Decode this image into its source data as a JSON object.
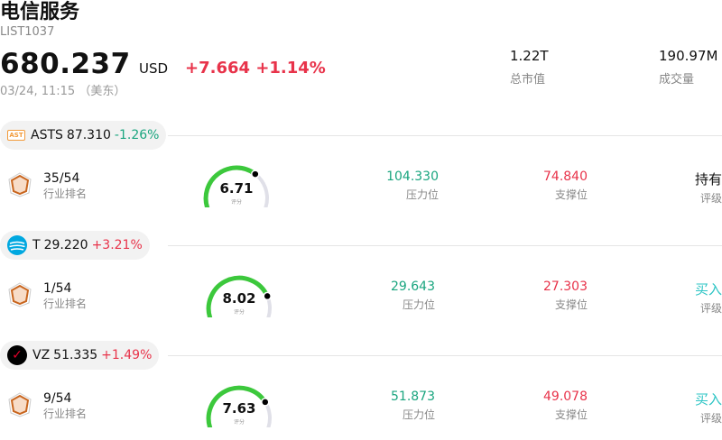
{
  "header": {
    "title": "电信服务",
    "code": "LIST1037",
    "price": "680.237",
    "currency": "USD",
    "change": "+7.664",
    "change_pct": "+1.14%",
    "time": "03/24, 11:15 （美东）",
    "stats": [
      {
        "value": "1.22T",
        "label": "总市值"
      },
      {
        "value": "190.97M",
        "label": "成交量"
      }
    ]
  },
  "stocks": [
    {
      "ticker": "ASTS",
      "price": "87.310",
      "change_pct": "-1.26%",
      "direction": "down",
      "logo": "asts-logo",
      "logo_text": "AST",
      "rank": "35/54",
      "rank_label": "行业排名",
      "score": "6.71",
      "score_label": "评分",
      "score_fraction": 0.671,
      "resistance": "104.330",
      "resistance_label": "压力位",
      "support": "74.840",
      "support_label": "支撑位",
      "rating": "持有",
      "rating_label": "评级",
      "rating_color": "#111111"
    },
    {
      "ticker": "T",
      "price": "29.220",
      "change_pct": "+3.21%",
      "direction": "up",
      "logo": "att-logo",
      "logo_text": "",
      "rank": "1/54",
      "rank_label": "行业排名",
      "score": "8.02",
      "score_label": "评分",
      "score_fraction": 0.802,
      "resistance": "29.643",
      "resistance_label": "压力位",
      "support": "27.303",
      "support_label": "支撑位",
      "rating": "买入",
      "rating_label": "评级",
      "rating_color": "#2bc4c4"
    },
    {
      "ticker": "VZ",
      "price": "51.335",
      "change_pct": "+1.49%",
      "direction": "up",
      "logo": "verizon-logo",
      "logo_text": "✓",
      "rank": "9/54",
      "rank_label": "行业排名",
      "score": "7.63",
      "score_label": "评分",
      "score_fraction": 0.763,
      "resistance": "51.873",
      "resistance_label": "压力位",
      "support": "49.078",
      "support_label": "支撑位",
      "rating": "买入",
      "rating_label": "评级",
      "rating_color": "#2bc4c4"
    }
  ],
  "colors": {
    "up": "#e8334a",
    "down": "#1aa57f",
    "gauge_green": "#3cc83c",
    "gauge_track": "#e0e0e8"
  }
}
